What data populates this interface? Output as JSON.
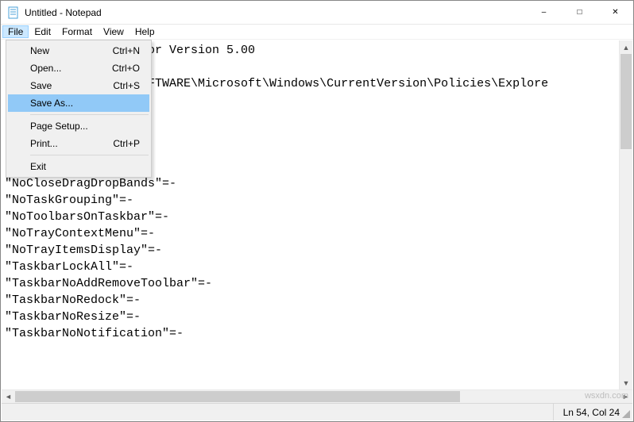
{
  "window": {
    "title": "Untitled - Notepad"
  },
  "menubar": {
    "file": "File",
    "edit": "Edit",
    "format": "Format",
    "view": "View",
    "help": "Help"
  },
  "file_menu": {
    "new": "New",
    "new_sc": "Ctrl+N",
    "open": "Open...",
    "open_sc": "Ctrl+O",
    "save": "Save",
    "save_sc": "Ctrl+S",
    "save_as": "Save As...",
    "page_setup": "Page Setup...",
    "print": "Print...",
    "print_sc": "Ctrl+P",
    "exit": "Exit"
  },
  "editor": {
    "lines": [
      "                 ditor Version 5.00",
      "",
      "                 \\SOFTWARE\\Microsoft\\Windows\\CurrentVersion\\Policies\\Explore",
      "",
      "",
      "",
      "",
      "",
      "\"NoCloseDragDropBands\"=-",
      "\"NoTaskGrouping\"=-",
      "\"NoToolbarsOnTaskbar\"=-",
      "\"NoTrayContextMenu\"=-",
      "\"NoTrayItemsDisplay\"=-",
      "\"TaskbarLockAll\"=-",
      "\"TaskbarNoAddRemoveToolbar\"=-",
      "\"TaskbarNoRedock\"=-",
      "\"TaskbarNoResize\"=-",
      "\"TaskbarNoNotification\"=-"
    ]
  },
  "status": {
    "pos": "Ln 54, Col 24"
  },
  "watermark": "wsxdn.com"
}
